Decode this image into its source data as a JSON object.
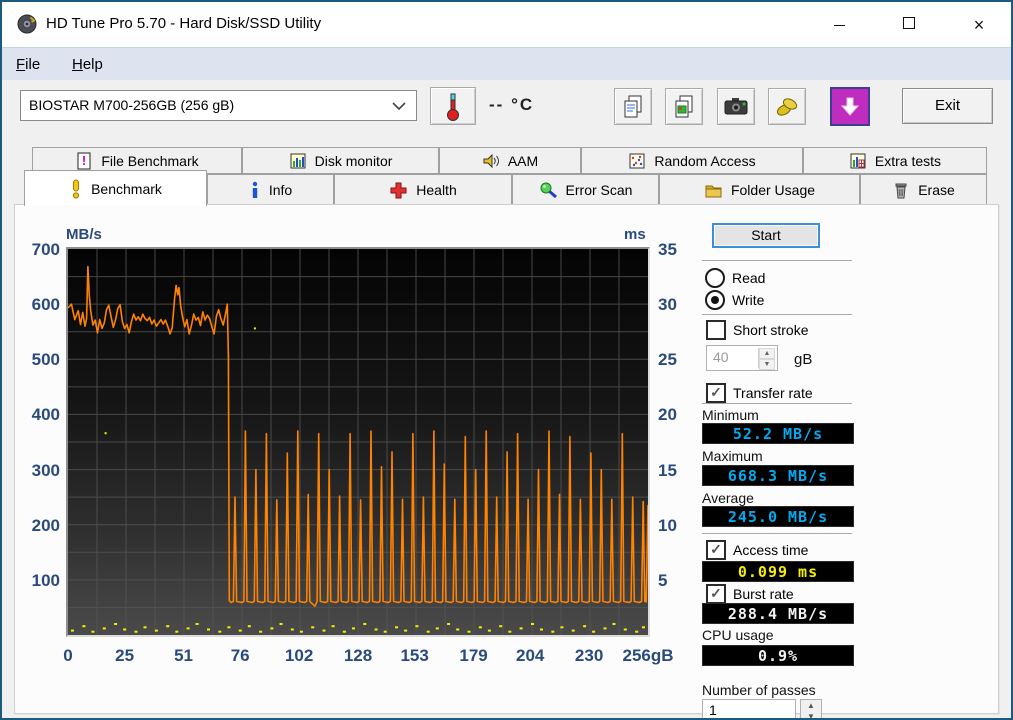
{
  "window": {
    "title": "HD Tune Pro 5.70 - Hard Disk/SSD Utility"
  },
  "menu": {
    "items": [
      {
        "key": "F",
        "rest": "ile"
      },
      {
        "key": "H",
        "rest": "elp"
      }
    ]
  },
  "toolbar": {
    "drive_selected": "BIOSTAR M700-256GB (256 gB)",
    "temperature": "--",
    "temperature_unit": "°C",
    "exit_label": "Exit"
  },
  "tabs": {
    "row1": [
      {
        "label": "File Benchmark"
      },
      {
        "label": "Disk monitor"
      },
      {
        "label": "AAM"
      },
      {
        "label": "Random Access"
      },
      {
        "label": "Extra tests"
      }
    ],
    "row2": [
      {
        "label": "Benchmark",
        "active": true
      },
      {
        "label": "Info"
      },
      {
        "label": "Health"
      },
      {
        "label": "Error Scan"
      },
      {
        "label": "Folder Usage"
      },
      {
        "label": "Erase"
      }
    ]
  },
  "panel": {
    "start_label": "Start",
    "read_label": "Read",
    "write_label": "Write",
    "mode_selected": "Write",
    "short_stroke_label": "Short stroke",
    "short_stroke_checked": false,
    "short_stroke_size": "40",
    "size_unit": "gB",
    "transfer_rate_label": "Transfer rate",
    "transfer_rate_checked": true,
    "minimum_label": "Minimum",
    "minimum_value": "52.2 MB/s",
    "maximum_label": "Maximum",
    "maximum_value": "668.3 MB/s",
    "average_label": "Average",
    "average_value": "245.0 MB/s",
    "access_time_label": "Access time",
    "access_time_checked": true,
    "access_time_value": "0.099 ms",
    "burst_rate_label": "Burst rate",
    "burst_rate_checked": true,
    "burst_rate_value": "288.4 MB/s",
    "cpu_usage_label": "CPU usage",
    "cpu_usage_value": "0.9%",
    "passes_label": "Number of passes",
    "passes_value": "1"
  },
  "chart_data": {
    "type": "line",
    "title": "",
    "x_axis": {
      "unit": "gB",
      "min": 0,
      "max": 256,
      "ticks": [
        0,
        25,
        51,
        76,
        102,
        128,
        153,
        179,
        204,
        230,
        256
      ]
    },
    "left_axis": {
      "label": "MB/s",
      "min": 0,
      "max": 700,
      "ticks": [
        100,
        200,
        300,
        400,
        500,
        600,
        700
      ]
    },
    "right_axis": {
      "label": "ms",
      "min": 0,
      "max": 35,
      "ticks": [
        5,
        10,
        15,
        20,
        25,
        30,
        35
      ]
    },
    "grid": {
      "x_step": 12.8,
      "y_step": 50,
      "color": "#565656"
    },
    "stats": {
      "minimum_mbs": 52.2,
      "maximum_mbs": 668.3,
      "average_mbs": 245.0,
      "access_time_ms": 0.099,
      "burst_rate_mbs": 288.4,
      "cpu_usage_pct": 0.9
    },
    "series": [
      {
        "name": "transfer_rate_write",
        "color": "#ff8200",
        "y_axis": "left",
        "unit": "MB/s",
        "points": [
          [
            0,
            593
          ],
          [
            1.5,
            600
          ],
          [
            3,
            572
          ],
          [
            4.5,
            588
          ],
          [
            5.5,
            563
          ],
          [
            6.5,
            585
          ],
          [
            7.5,
            560
          ],
          [
            8.2,
            574
          ],
          [
            8.8,
            668
          ],
          [
            9.4,
            615
          ],
          [
            10,
            588
          ],
          [
            11,
            562
          ],
          [
            12,
            571
          ],
          [
            13,
            548
          ],
          [
            14,
            572
          ],
          [
            15,
            556
          ],
          [
            16,
            566
          ],
          [
            17,
            590
          ],
          [
            18,
            598
          ],
          [
            19,
            578
          ],
          [
            20,
            558
          ],
          [
            21,
            572
          ],
          [
            22,
            592
          ],
          [
            23,
            599
          ],
          [
            24,
            568
          ],
          [
            25,
            556
          ],
          [
            26,
            563
          ],
          [
            27,
            548
          ],
          [
            28,
            568
          ],
          [
            29,
            582
          ],
          [
            30,
            571
          ],
          [
            31,
            577
          ],
          [
            32,
            570
          ],
          [
            33,
            582
          ],
          [
            34,
            574
          ],
          [
            35,
            570
          ],
          [
            36,
            576
          ],
          [
            37,
            564
          ],
          [
            38,
            571
          ],
          [
            39,
            560
          ],
          [
            40,
            566
          ],
          [
            41,
            572
          ],
          [
            42,
            564
          ],
          [
            43,
            571
          ],
          [
            44,
            560
          ],
          [
            45,
            546
          ],
          [
            46,
            557
          ],
          [
            47,
            608
          ],
          [
            47.7,
            634
          ],
          [
            48.4,
            617
          ],
          [
            49,
            630
          ],
          [
            49.7,
            598
          ],
          [
            50.5,
            578
          ],
          [
            51.5,
            559
          ],
          [
            52.5,
            572
          ],
          [
            53.5,
            546
          ],
          [
            54.5,
            562
          ],
          [
            55.5,
            582
          ],
          [
            56.5,
            571
          ],
          [
            57.5,
            576
          ],
          [
            58.5,
            561
          ],
          [
            59.5,
            586
          ],
          [
            60.5,
            571
          ],
          [
            61.5,
            580
          ],
          [
            62.5,
            574
          ],
          [
            63.5,
            559
          ],
          [
            64.5,
            546
          ],
          [
            65.5,
            578
          ],
          [
            66.5,
            590
          ],
          [
            67.5,
            574
          ],
          [
            68.5,
            562
          ],
          [
            69.5,
            582
          ],
          [
            70.3,
            600
          ],
          [
            70.8,
            505
          ],
          [
            71.2,
            62
          ]
        ],
        "spike_segment": {
          "x_start": 71.2,
          "period": 4.62,
          "baseline": 61,
          "peaks": [
            250,
            370,
            300,
            365,
            245,
            330,
            370,
            255,
            365,
            300,
            252,
            365,
            245,
            370,
            305,
            332,
            246,
            365,
            250,
            370,
            310,
            246,
            360,
            300,
            370,
            250,
            332,
            365,
            246,
            300,
            370,
            255,
            360,
            246,
            330,
            300,
            246,
            365,
            250,
            242
          ],
          "min_valley": {
            "cycle": 8,
            "value": 52.2
          }
        },
        "tail_points": [
          [
            255.2,
            60
          ],
          [
            256,
            236
          ]
        ]
      },
      {
        "name": "access_time",
        "color": "#f6f000",
        "y_axis": "right",
        "unit": "ms",
        "baseline_points": [
          [
            2,
            0.4
          ],
          [
            7,
            0.8
          ],
          [
            11,
            0.3
          ],
          [
            16,
            0.6
          ],
          [
            21,
            1.0
          ],
          [
            25,
            0.5
          ],
          [
            30,
            0.3
          ],
          [
            34,
            0.7
          ],
          [
            39,
            0.4
          ],
          [
            44,
            0.8
          ],
          [
            48,
            0.3
          ],
          [
            53,
            0.6
          ],
          [
            57,
            1.0
          ],
          [
            62,
            0.5
          ],
          [
            67,
            0.3
          ],
          [
            71,
            0.7
          ],
          [
            76,
            0.4
          ],
          [
            80,
            0.8
          ],
          [
            85,
            0.3
          ],
          [
            90,
            0.6
          ],
          [
            94,
            1.0
          ],
          [
            99,
            0.5
          ],
          [
            103,
            0.3
          ],
          [
            108,
            0.7
          ],
          [
            113,
            0.4
          ],
          [
            117,
            0.8
          ],
          [
            122,
            0.3
          ],
          [
            126,
            0.6
          ],
          [
            131,
            1.0
          ],
          [
            136,
            0.5
          ],
          [
            140,
            0.3
          ],
          [
            145,
            0.7
          ],
          [
            149,
            0.4
          ],
          [
            154,
            0.8
          ],
          [
            159,
            0.3
          ],
          [
            163,
            0.6
          ],
          [
            168,
            1.0
          ],
          [
            172,
            0.5
          ],
          [
            177,
            0.3
          ],
          [
            182,
            0.7
          ],
          [
            186,
            0.4
          ],
          [
            191,
            0.8
          ],
          [
            195,
            0.3
          ],
          [
            200,
            0.6
          ],
          [
            205,
            1.0
          ],
          [
            209,
            0.5
          ],
          [
            214,
            0.3
          ],
          [
            218,
            0.7
          ],
          [
            223,
            0.4
          ],
          [
            228,
            0.8
          ],
          [
            232,
            0.3
          ],
          [
            237,
            0.6
          ],
          [
            241,
            1.0
          ],
          [
            246,
            0.5
          ],
          [
            251,
            0.3
          ],
          [
            254,
            0.7
          ]
        ],
        "outlier_points": [
          [
            16.6,
            18.3
          ],
          [
            82.5,
            27.8
          ]
        ]
      }
    ]
  }
}
